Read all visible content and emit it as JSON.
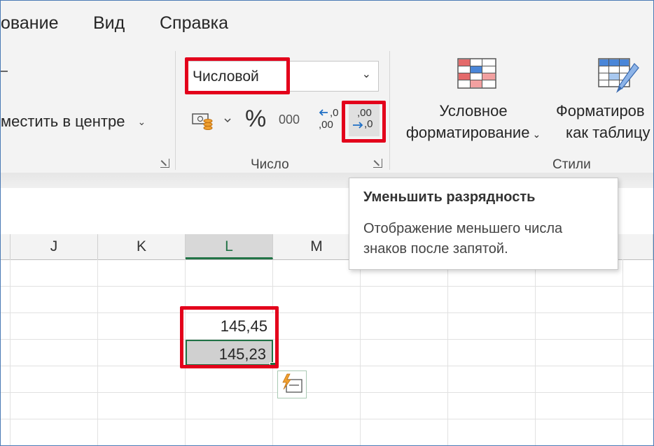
{
  "menu": {
    "item_1": "ование",
    "item_2": "Вид",
    "item_3": "Справка"
  },
  "alignment": {
    "merge_label": "местить в центре"
  },
  "number": {
    "format_value": "Числовой",
    "percent_symbol": "%",
    "thousands_symbol": "000",
    "increase_top": ",0",
    "increase_bottom": ",00",
    "decrease_top": ",00",
    "decrease_bottom": ",0",
    "group_label": "Число"
  },
  "styles": {
    "conditional_line1": "Условное",
    "conditional_line2": "форматирование",
    "table_line1": "Форматиров",
    "table_line2": "как таблицу",
    "group_label": "Стили"
  },
  "columns": [
    "J",
    "K",
    "L",
    "M"
  ],
  "cells": {
    "l1": "145,45",
    "l2": "145,23"
  },
  "tooltip": {
    "title": "Уменьшить разрядность",
    "description": "Отображение меньшего числа знаков после запятой."
  },
  "colors": {
    "highlight_red": "#e3001b",
    "excel_green": "#217346",
    "accent_blue": "#1f6fc5"
  }
}
